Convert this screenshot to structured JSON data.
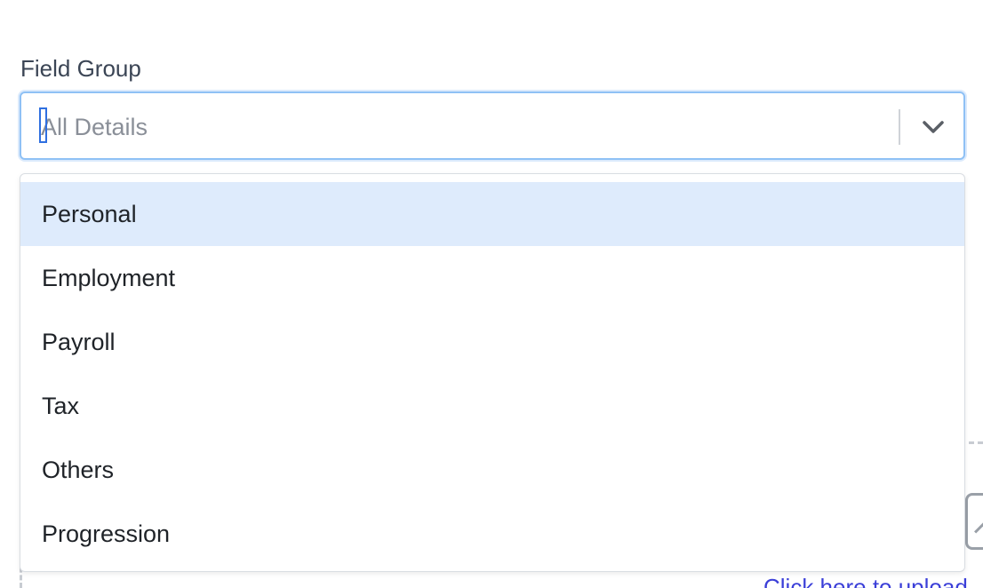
{
  "field": {
    "label": "Field Group",
    "placeholder": "All Details"
  },
  "dropdown": {
    "options": [
      {
        "label": "Personal",
        "highlighted": true
      },
      {
        "label": "Employment"
      },
      {
        "label": "Payroll"
      },
      {
        "label": "Tax"
      },
      {
        "label": "Others"
      },
      {
        "label": "Progression"
      }
    ]
  },
  "background": {
    "upload_link": "Click here to upload"
  },
  "icons": {
    "dropdown_indicator": "chevron-down-icon",
    "upload_area": "image-upload-icon"
  },
  "colors": {
    "focus_border": "#8fc1f5",
    "option_highlight": "#deebfc",
    "link": "#3b3fd8",
    "label_text": "#3b4555"
  }
}
